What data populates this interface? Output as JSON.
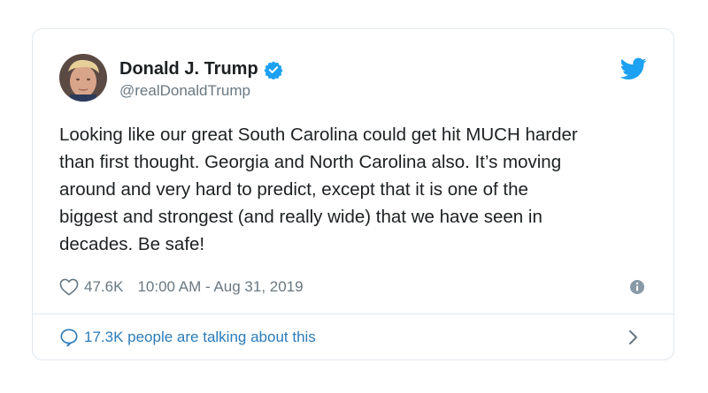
{
  "author": {
    "display_name": "Donald J. Trump",
    "handle": "@realDonaldTrump",
    "verified": true
  },
  "tweet": {
    "text": "Looking like our great South Carolina could get hit MUCH harder\nthan first thought. Georgia and North Carolina also. It’s moving\naround and very hard to predict, except that it is one of the\nbiggest and strongest (and really wide) that we have seen in\ndecades. Be safe!"
  },
  "meta": {
    "likes": "47.6K",
    "timestamp": "10:00 AM - Aug 31, 2019"
  },
  "footer": {
    "conversation": "17.3K people are talking about this"
  },
  "icons": {
    "brand": "twitter-bird-icon",
    "verified": "verified-badge-icon",
    "like": "heart-icon",
    "info": "info-icon",
    "reply": "speech-bubble-icon",
    "more": "chevron-right-icon"
  },
  "colors": {
    "brand_blue": "#1da1f2",
    "link_blue": "#2b7bb9",
    "text": "#1c2022",
    "muted": "#697882",
    "border": "#e1e8ed"
  }
}
